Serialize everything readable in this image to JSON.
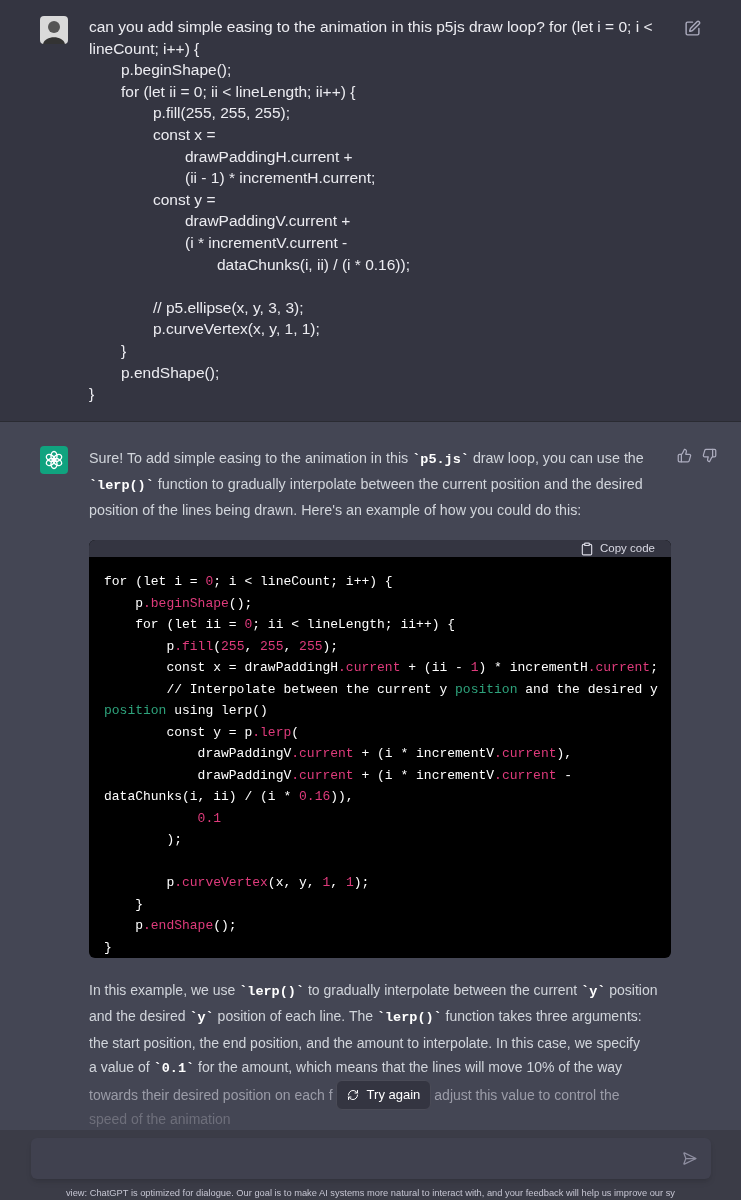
{
  "user_message": {
    "lines": [
      {
        "kind": "text",
        "text": "can you add simple easing to the animation in this p5js draw loop? for (let i = 0; i < lineCount; i++) {"
      },
      {
        "kind": "text",
        "text": "\tp.beginShape();"
      },
      {
        "kind": "text",
        "text": "\tfor (let ii = 0; ii < lineLength; ii++) {"
      },
      {
        "kind": "text",
        "text": "\t\tp.fill(255, 255, 255);"
      },
      {
        "kind": "text",
        "text": "\t\tconst x ="
      },
      {
        "kind": "text",
        "text": "\t\t\tdrawPaddingH.current +"
      },
      {
        "kind": "text",
        "text": "\t\t\t(ii - 1) * incrementH.current;"
      },
      {
        "kind": "text",
        "text": "\t\tconst y ="
      },
      {
        "kind": "text",
        "text": "\t\t\tdrawPaddingV.current +"
      },
      {
        "kind": "text",
        "text": "\t\t\t(i * incrementV.current -"
      },
      {
        "kind": "text",
        "text": "\t\t\t\tdataChunks(i, ii) / (i * 0.16));"
      },
      {
        "kind": "blank"
      },
      {
        "kind": "text",
        "text": "\t\t// p5.ellipse(x, y, 3, 3);"
      },
      {
        "kind": "text",
        "text": "\t\tp.curveVertex(x, y, 1, 1);"
      },
      {
        "kind": "text",
        "text": "\t}"
      },
      {
        "kind": "text",
        "text": "\tp.endShape();"
      },
      {
        "kind": "text",
        "text": "}"
      }
    ]
  },
  "assistant": {
    "intro": [
      [
        {
          "text": "Sure! To add simple easing to the animation in this "
        },
        {
          "text": "`p5.js`",
          "kind": "code"
        },
        {
          "text": " draw loop, you can use the"
        }
      ],
      [
        {
          "text": "`lerp()`",
          "kind": "code"
        },
        {
          "text": " function to gradually interpolate between the current position and the desired"
        }
      ],
      [
        {
          "text": "position of the lines being drawn. Here's an example of how you could do this:"
        }
      ]
    ],
    "code_block": {
      "copy_label": "Copy code",
      "lines": [
        {
          "kind": "code",
          "segments": [
            {
              "text": "for (let i = "
            },
            {
              "text": "0",
              "kind": "num"
            },
            {
              "text": "; i < lineCount; i++) {"
            }
          ]
        },
        {
          "kind": "code",
          "segments": [
            {
              "text": "    p"
            },
            {
              "text": ".beginShape",
              "kind": "prop"
            },
            {
              "text": "();"
            }
          ]
        },
        {
          "kind": "code",
          "segments": [
            {
              "text": "    for (let ii = "
            },
            {
              "text": "0",
              "kind": "num"
            },
            {
              "text": "; ii < lineLength; ii++) {"
            }
          ]
        },
        {
          "kind": "code",
          "segments": [
            {
              "text": "        p"
            },
            {
              "text": ".fill",
              "kind": "prop"
            },
            {
              "text": "("
            },
            {
              "text": "255",
              "kind": "num"
            },
            {
              "text": ", "
            },
            {
              "text": "255",
              "kind": "num"
            },
            {
              "text": ", "
            },
            {
              "text": "255",
              "kind": "num"
            },
            {
              "text": ");"
            }
          ]
        },
        {
          "kind": "code",
          "segments": [
            {
              "text": "        const x = drawPaddingH"
            },
            {
              "text": ".current",
              "kind": "prop"
            },
            {
              "text": " + (ii - "
            },
            {
              "text": "1",
              "kind": "num"
            },
            {
              "text": ") * incrementH"
            },
            {
              "text": ".current",
              "kind": "prop"
            },
            {
              "text": ";"
            }
          ]
        },
        {
          "kind": "code",
          "segments": [
            {
              "text": "        // Interpolate between the current y "
            },
            {
              "text": "position",
              "kind": "green"
            },
            {
              "text": " and the desired y"
            }
          ]
        },
        {
          "kind": "code",
          "segments": [
            {
              "text": "position",
              "kind": "green"
            },
            {
              "text": " using lerp()"
            }
          ]
        },
        {
          "kind": "code",
          "segments": [
            {
              "text": "        const y = p"
            },
            {
              "text": ".lerp",
              "kind": "prop"
            },
            {
              "text": "("
            }
          ]
        },
        {
          "kind": "code",
          "segments": [
            {
              "text": "            drawPaddingV"
            },
            {
              "text": ".current",
              "kind": "prop"
            },
            {
              "text": " + (i * incrementV"
            },
            {
              "text": ".current",
              "kind": "prop"
            },
            {
              "text": "),"
            }
          ]
        },
        {
          "kind": "code",
          "segments": [
            {
              "text": "            drawPaddingV"
            },
            {
              "text": ".current",
              "kind": "prop"
            },
            {
              "text": " + (i * incrementV"
            },
            {
              "text": ".current",
              "kind": "prop"
            },
            {
              "text": " -"
            }
          ]
        },
        {
          "kind": "code",
          "segments": [
            {
              "text": "dataChunks(i, ii) / (i * "
            },
            {
              "text": "0.16",
              "kind": "num"
            },
            {
              "text": ")),"
            }
          ]
        },
        {
          "kind": "code",
          "segments": [
            {
              "text": "            0.1",
              "kind": "num"
            }
          ]
        },
        {
          "kind": "code",
          "segments": [
            {
              "text": "        );"
            }
          ]
        },
        {
          "kind": "blank"
        },
        {
          "kind": "code",
          "segments": [
            {
              "text": "        p"
            },
            {
              "text": ".curveVertex",
              "kind": "prop"
            },
            {
              "text": "(x, y, "
            },
            {
              "text": "1",
              "kind": "num"
            },
            {
              "text": ", "
            },
            {
              "text": "1",
              "kind": "num"
            },
            {
              "text": ");"
            }
          ]
        },
        {
          "kind": "code",
          "segments": [
            {
              "text": "    }"
            }
          ]
        },
        {
          "kind": "code",
          "segments": [
            {
              "text": "    p"
            },
            {
              "text": ".endShape",
              "kind": "prop"
            },
            {
              "text": "();"
            }
          ]
        },
        {
          "kind": "code",
          "segments": [
            {
              "text": "}"
            }
          ]
        }
      ]
    },
    "outro": [
      [
        {
          "text": "In this example, we use "
        },
        {
          "text": "`lerp()`",
          "kind": "code"
        },
        {
          "text": " to gradually interpolate between the current "
        },
        {
          "text": "`y`",
          "kind": "code"
        },
        {
          "text": " position"
        }
      ],
      [
        {
          "text": "and the desired "
        },
        {
          "text": "`y`",
          "kind": "code"
        },
        {
          "text": " position of each line. The "
        },
        {
          "text": "`lerp()`",
          "kind": "code"
        },
        {
          "text": " function takes three arguments:"
        }
      ],
      [
        {
          "text": "the start position, the end position, and the amount to interpolate. In this case, we specify"
        }
      ],
      [
        {
          "text": "a value of "
        },
        {
          "text": "`0.1`",
          "kind": "code"
        },
        {
          "text": " for the amount, which means that the lines will move 10% of the way"
        }
      ]
    ],
    "covered_line": {
      "before": "towards their desired position on each f",
      "after": "adjust this value to control the"
    },
    "last_line": "speed of the animation"
  },
  "try_again_button": {
    "label": "Try again"
  },
  "disclaimer": "view: ChatGPT is optimized for dialogue. Our goal is to make AI systems more natural to interact with, and your feedback will help us improve our sy"
}
